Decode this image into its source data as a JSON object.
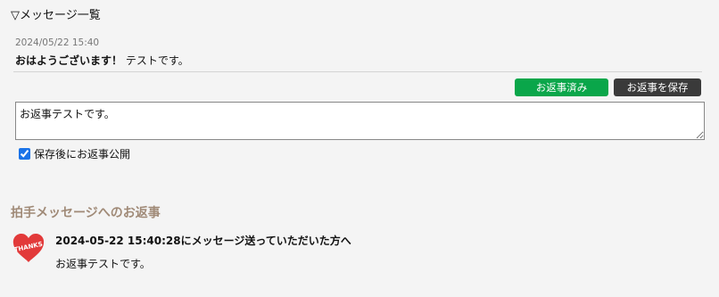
{
  "messages_section": {
    "toggle_label": "▽メッセージ一覧",
    "message": {
      "date": "2024/05/22 15:40",
      "greeting": "おはようございます！",
      "text": "テストです。"
    },
    "buttons": {
      "replied_label": "お返事済み",
      "save_label": "お返事を保存"
    },
    "reply_value": "お返事テストです。",
    "publish_checkbox": {
      "label": "保存後にお返事公開",
      "checked": true
    }
  },
  "reply_section": {
    "heading": "拍手メッセージへのお返事",
    "icon_text": "THANKS",
    "entry": {
      "title": "2024-05-22 15:40:28にメッセージ送っていただいた方へ",
      "body": "お返事テストです。"
    }
  },
  "colors": {
    "replied_button": "#0aa64a",
    "save_button": "#3a3a3a",
    "heading": "#a08a77",
    "heart": "#e23a3a"
  }
}
